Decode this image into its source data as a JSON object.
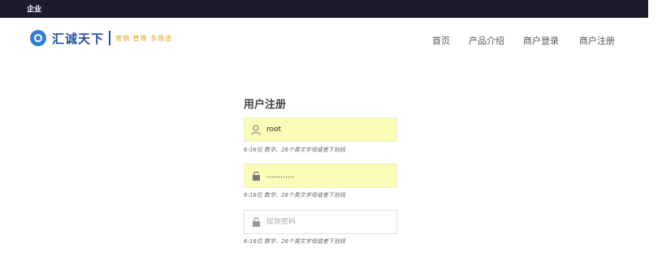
{
  "topbar": {
    "label": "企业"
  },
  "brand": {
    "name": "汇诚天下",
    "slogan": "营销 管理 多用途",
    "accent": "#2f7fd3"
  },
  "nav": {
    "items": [
      {
        "label": "首页"
      },
      {
        "label": "产品介绍"
      },
      {
        "label": "商户登录"
      },
      {
        "label": "商户注册"
      }
    ]
  },
  "form": {
    "title": "用户注册",
    "username": {
      "value": "root",
      "placeholder": "",
      "icon": "user-icon"
    },
    "username_hint": "6-16位 数字、26个英文字母或者下划线",
    "password": {
      "value": "............",
      "placeholder": "",
      "icon": "lock-icon"
    },
    "password_hint": "6-16位 数字、26个英文字母或者下划线",
    "confirm": {
      "value": "",
      "placeholder": "提现密码",
      "icon": "lock-icon"
    },
    "confirm_hint": "6-16位 数字、26个英文字母或者下划线",
    "autofill_color": "#fafcb8"
  }
}
